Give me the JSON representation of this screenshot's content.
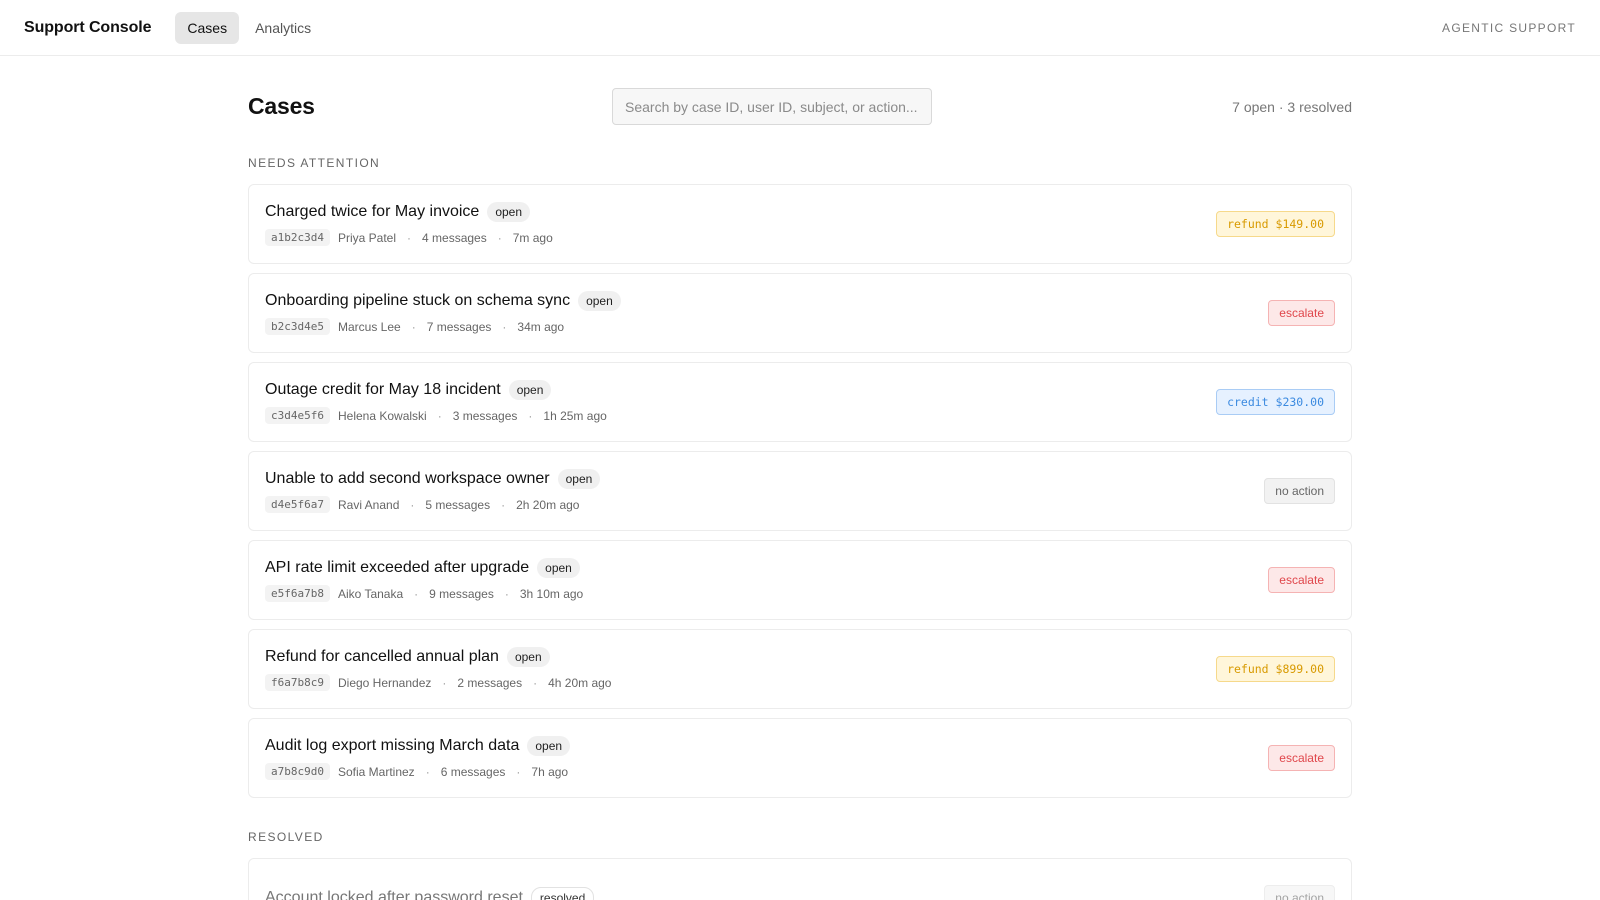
{
  "app": {
    "brand": "Support Console",
    "tabs": [
      {
        "label": "Cases",
        "active": true
      },
      {
        "label": "Analytics",
        "active": false
      }
    ],
    "top_right": "AGENTIC SUPPORT"
  },
  "page": {
    "title": "Cases",
    "search_placeholder": "Search by case ID, user ID, subject, or action...",
    "counts": "7 open · 3 resolved"
  },
  "sections": {
    "attention_label": "NEEDS ATTENTION",
    "resolved_label": "RESOLVED"
  },
  "cases": [
    {
      "subject": "Charged twice for May invoice",
      "status": "open",
      "id": "a1b2c3d4",
      "user": "Priya Patel",
      "messages": "4 messages",
      "time": "7m ago",
      "action": "refund $149.00",
      "action_type": "refund"
    },
    {
      "subject": "Onboarding pipeline stuck on schema sync",
      "status": "open",
      "id": "b2c3d4e5",
      "user": "Marcus Lee",
      "messages": "7 messages",
      "time": "34m ago",
      "action": "escalate",
      "action_type": "escalate"
    },
    {
      "subject": "Outage credit for May 18 incident",
      "status": "open",
      "id": "c3d4e5f6",
      "user": "Helena Kowalski",
      "messages": "3 messages",
      "time": "1h 25m ago",
      "action": "credit $230.00",
      "action_type": "credit"
    },
    {
      "subject": "Unable to add second workspace owner",
      "status": "open",
      "id": "d4e5f6a7",
      "user": "Ravi Anand",
      "messages": "5 messages",
      "time": "2h 20m ago",
      "action": "no action",
      "action_type": "none"
    },
    {
      "subject": "API rate limit exceeded after upgrade",
      "status": "open",
      "id": "e5f6a7b8",
      "user": "Aiko Tanaka",
      "messages": "9 messages",
      "time": "3h 10m ago",
      "action": "escalate",
      "action_type": "escalate"
    },
    {
      "subject": "Refund for cancelled annual plan",
      "status": "open",
      "id": "f6a7b8c9",
      "user": "Diego Hernandez",
      "messages": "2 messages",
      "time": "4h 20m ago",
      "action": "refund $899.00",
      "action_type": "refund"
    },
    {
      "subject": "Audit log export missing March data",
      "status": "open",
      "id": "a7b8c9d0",
      "user": "Sofia Martinez",
      "messages": "6 messages",
      "time": "7h ago",
      "action": "escalate",
      "action_type": "escalate"
    }
  ],
  "resolved_cases": [
    {
      "subject": "Account locked after password reset",
      "status": "resolved",
      "action": "no action",
      "action_type": "none"
    }
  ],
  "colors": {
    "refund": "#d89a00",
    "escalate": "#e0474c",
    "credit": "#3b8ae0",
    "none": "#666666"
  }
}
